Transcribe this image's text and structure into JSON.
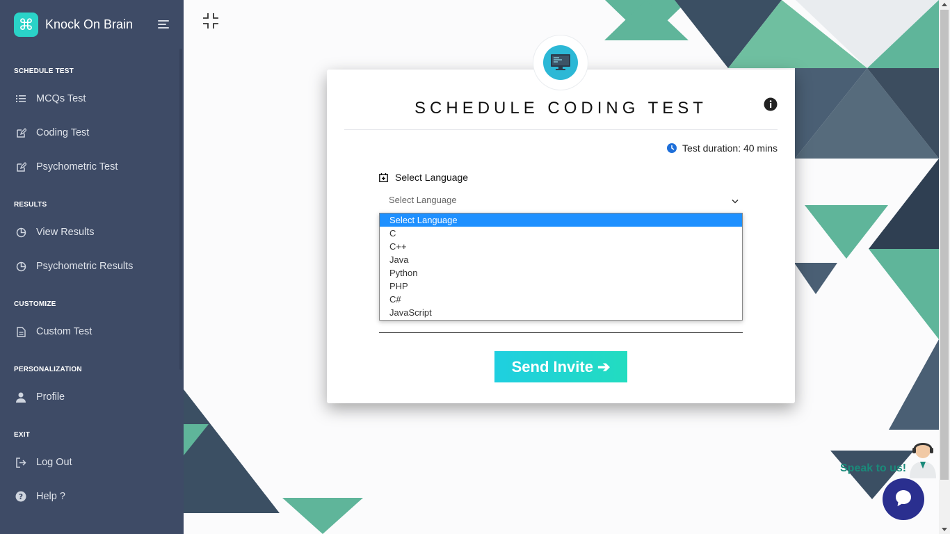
{
  "app": {
    "name": "Knock On Brain"
  },
  "sidebar": {
    "sections": [
      {
        "title": "SCHEDULE TEST",
        "items": [
          {
            "label": "MCQs Test",
            "icon": "list-icon"
          },
          {
            "label": "Coding Test",
            "icon": "edit-icon"
          },
          {
            "label": "Psychometric Test",
            "icon": "edit-icon"
          }
        ]
      },
      {
        "title": "RESULTS",
        "items": [
          {
            "label": "View Results",
            "icon": "pie-chart-icon"
          },
          {
            "label": "Psychometric Results",
            "icon": "pie-chart-icon"
          }
        ]
      },
      {
        "title": "CUSTOMIZE",
        "items": [
          {
            "label": "Custom Test",
            "icon": "file-icon"
          }
        ]
      },
      {
        "title": "PERSONALIZATION",
        "items": [
          {
            "label": "Profile",
            "icon": "user-icon"
          }
        ]
      },
      {
        "title": "EXIT",
        "items": [
          {
            "label": "Log Out",
            "icon": "logout-icon"
          },
          {
            "label": "Help ?",
            "icon": "help-icon"
          }
        ]
      }
    ]
  },
  "card": {
    "title": "SCHEDULE CODING TEST",
    "duration": "Test duration: 40 mins",
    "language_label": "Select Language",
    "select_value": "Select Language",
    "options": [
      "Select Language",
      "C",
      "C++",
      "Java",
      "Python",
      "PHP",
      "C#",
      "JavaScript"
    ],
    "selected_option": "Select Language",
    "send_label": "Send Invite"
  },
  "chat": {
    "label": "Speak to us!"
  },
  "colors": {
    "sidebar_bg": "#3e4b66",
    "accent": "#22d3c8",
    "highlight": "#1e90ff",
    "chat": "#2a2f8f"
  }
}
